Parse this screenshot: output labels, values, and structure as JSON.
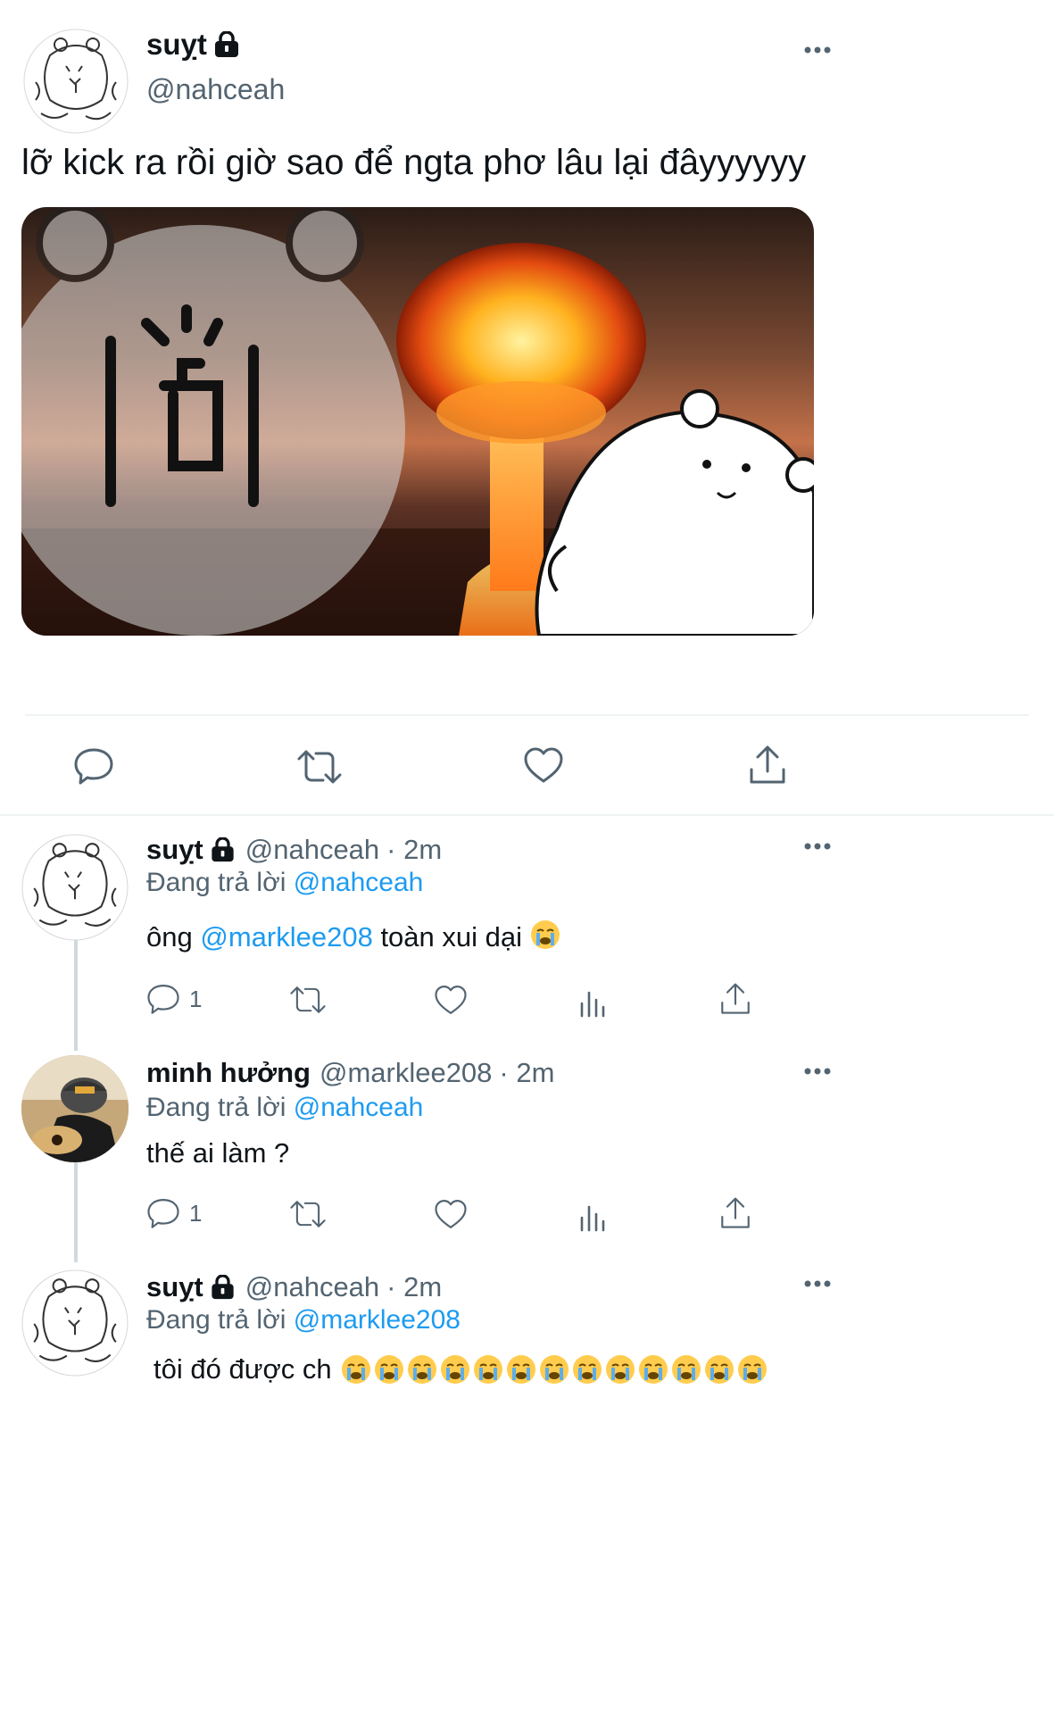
{
  "main_tweet": {
    "display_name": "suỵt",
    "handle": "@nahceah",
    "text": "lỡ kick ra rồi giờ sao để ngta phơ lâu lại đâyyyyyy"
  },
  "replies": [
    {
      "display_name": "suỵt",
      "handle": "@nahceah",
      "meta": "· 2m",
      "replying_prefix": "Đang trả lời",
      "replying_to": "@nahceah",
      "text_before": "ông",
      "mention": "@marklee208",
      "text_after": "toàn xui dại",
      "emoji": "loudly-crying-face",
      "reply_count": "1"
    },
    {
      "display_name": "minh hưởng",
      "handle": "@marklee208",
      "meta": "· 2m",
      "replying_prefix": "Đang trả lời",
      "replying_to": "@nahceah",
      "text": "thế ai làm ?",
      "reply_count": "1"
    },
    {
      "display_name": "suỵt",
      "handle": "@nahceah",
      "meta": "· 2m",
      "replying_prefix": "Đang trả lời",
      "replying_to": "@marklee208",
      "text": "tôi đó được ch",
      "emoji": "loudly-crying-face",
      "emoji_count": 13
    }
  ],
  "icons": {
    "more": "more-horizontal-icon",
    "lock": "lock-icon",
    "reply": "reply-icon",
    "retweet": "retweet-icon",
    "like": "heart-icon",
    "share": "share-icon",
    "analytics": "analytics-icon"
  },
  "colors": {
    "link": "#1d9bf0",
    "secondary_text": "#536471",
    "divider": "#eff3f4"
  }
}
